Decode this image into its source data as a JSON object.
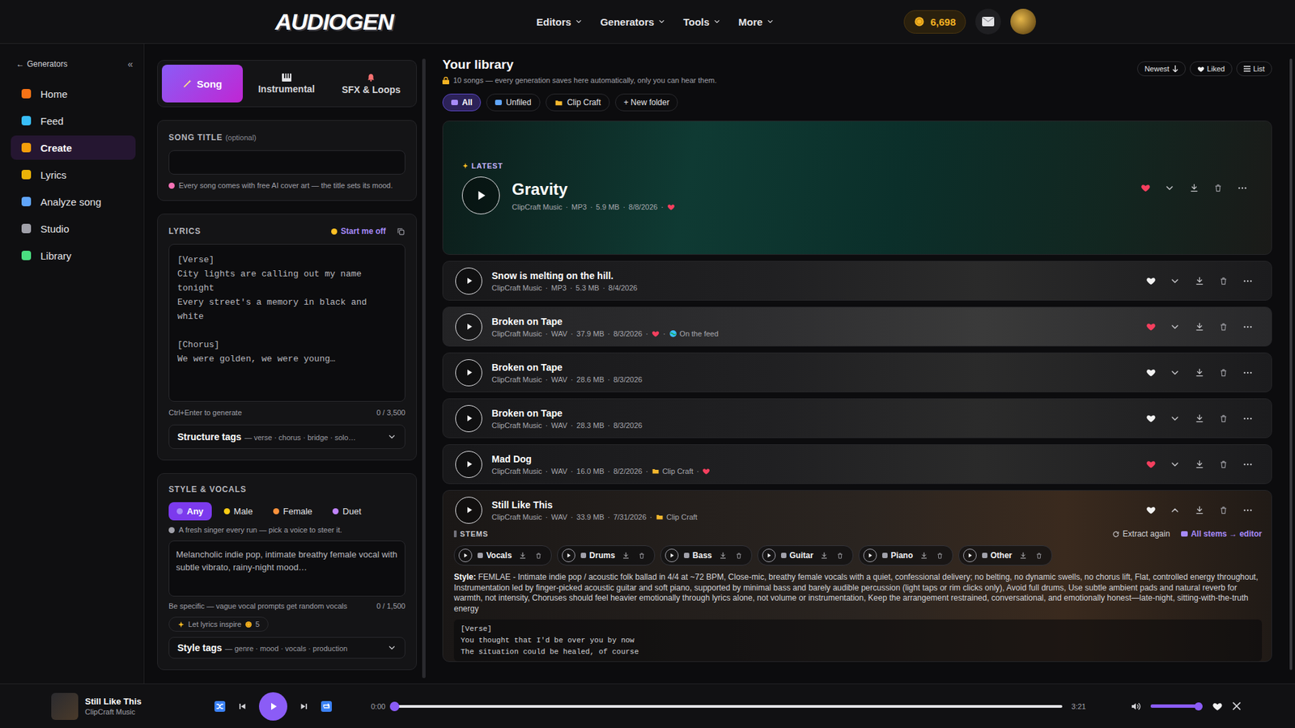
{
  "topbar": {
    "logo": "AUDIOGEN",
    "nav": [
      {
        "label": "Editors"
      },
      {
        "label": "Generators"
      },
      {
        "label": "Tools"
      },
      {
        "label": "More"
      }
    ],
    "credits": "6,698"
  },
  "sidebar": {
    "back": "←",
    "back_label": "Generators",
    "collapse": "«",
    "items": [
      {
        "label": "Home",
        "selected": false
      },
      {
        "label": "Feed",
        "selected": false
      },
      {
        "label": "Create",
        "selected": true
      },
      {
        "label": "Lyrics",
        "selected": false
      },
      {
        "label": "Analyze song",
        "selected": false
      },
      {
        "label": "Studio",
        "selected": false
      },
      {
        "label": "Library",
        "selected": false
      }
    ]
  },
  "create": {
    "tabs": [
      {
        "label": "Song",
        "selected": true
      },
      {
        "label": "Instrumental",
        "selected": false
      },
      {
        "label": "SFX & Loops",
        "selected": false
      }
    ],
    "title_field": {
      "label": "SONG TITLE",
      "optional": "(optional)",
      "value": "",
      "hint": "Every song comes with free AI cover art — the title sets its mood."
    },
    "lyrics": {
      "label": "LYRICS",
      "action": "Start me off",
      "placeholder": "[Verse]\nCity lights are calling out my name tonight\nEvery street's a memory in black and white\n\n[Chorus]\nWe were golden, we were young…",
      "shortcut": "Ctrl+Enter to generate",
      "count": "0 / 3,500",
      "structure_label": "Structure tags",
      "structure_hint": "— verse · chorus · bridge · solo…"
    },
    "style": {
      "label": "STYLE & VOCALS",
      "voices": [
        {
          "label": "Any",
          "selected": true
        },
        {
          "label": "Male",
          "selected": false
        },
        {
          "label": "Female",
          "selected": false
        },
        {
          "label": "Duet",
          "selected": false
        }
      ],
      "voice_hint": "A fresh singer every run — pick a voice to steer it.",
      "placeholder": "Melancholic indie pop, intimate breathy female vocal with subtle vibrato, rainy-night mood…",
      "hint": "Be specific — vague vocal prompts get random vocals",
      "count": "0 / 1,500",
      "inspire": "Let lyrics inspire",
      "inspire_cost": "5",
      "tags_label": "Style tags",
      "tags_hint": "— genre · mood · vocals · production"
    }
  },
  "library": {
    "title": "Your library",
    "subtitle": "10 songs — every generation saves here automatically, only you can hear them.",
    "sort": "Newest",
    "liked_filter": "Liked",
    "view": "List",
    "filters": [
      {
        "label": "All",
        "selected": true
      },
      {
        "label": "Unfiled",
        "selected": false
      },
      {
        "label": "Clip Craft",
        "selected": false
      }
    ],
    "new_folder": "+ New folder",
    "meta_separator": "·",
    "latest": {
      "tag": "LATEST",
      "title": "Gravity",
      "meta": [
        "ClipCraft Music",
        "MP3",
        "5.9 MB",
        "8/8/2026"
      ],
      "extras": [
        {
          "kind": "heart",
          "text": ""
        }
      ],
      "liked": true,
      "expanded": false,
      "highlighted": false
    },
    "rows": [
      {
        "title": "Snow is melting on the hill.",
        "meta": [
          "ClipCraft Music",
          "MP3",
          "5.3 MB",
          "8/4/2026"
        ],
        "extras": [],
        "liked": false,
        "expanded": false,
        "highlighted": false
      },
      {
        "title": "Broken on Tape",
        "meta": [
          "ClipCraft Music",
          "WAV",
          "37.9 MB",
          "8/3/2026"
        ],
        "extras": [
          {
            "kind": "heart",
            "text": ""
          },
          {
            "kind": "feed",
            "text": "On the feed"
          }
        ],
        "liked": true,
        "expanded": false,
        "highlighted": true
      },
      {
        "title": "Broken on Tape",
        "meta": [
          "ClipCraft Music",
          "WAV",
          "28.6 MB",
          "8/3/2026"
        ],
        "extras": [],
        "liked": false,
        "expanded": false,
        "highlighted": false
      },
      {
        "title": "Broken on Tape",
        "meta": [
          "ClipCraft Music",
          "WAV",
          "28.3 MB",
          "8/3/2026"
        ],
        "extras": [],
        "liked": false,
        "expanded": false,
        "highlighted": false
      },
      {
        "title": "Mad Dog",
        "meta": [
          "ClipCraft Music",
          "WAV",
          "16.0 MB",
          "8/2/2026"
        ],
        "extras": [
          {
            "kind": "folder",
            "text": "Clip Craft"
          },
          {
            "kind": "heart",
            "text": ""
          }
        ],
        "liked": true,
        "expanded": false,
        "highlighted": false
      },
      {
        "title": "Still Like This",
        "meta": [
          "ClipCraft Music",
          "WAV",
          "33.9 MB",
          "7/31/2026"
        ],
        "extras": [
          {
            "kind": "folder",
            "text": "Clip Craft"
          }
        ],
        "liked": false,
        "expanded": true,
        "highlighted": false
      }
    ],
    "detail": {
      "stems_label": "STEMS",
      "extract": "Extract again",
      "editor": "All stems → editor",
      "stems": [
        {
          "name": "Vocals"
        },
        {
          "name": "Drums"
        },
        {
          "name": "Bass"
        },
        {
          "name": "Guitar"
        },
        {
          "name": "Piano"
        },
        {
          "name": "Other"
        }
      ],
      "style_label": "Style:",
      "style_text": "FEMLAE - Intimate indie pop / acoustic folk ballad in 4/4 at ~72 BPM, Close-mic, breathy female vocals with a quiet, confessional delivery; no belting, no dynamic swells, no chorus lift, Flat, controlled energy throughout, Instrumentation led by finger-picked acoustic guitar and soft piano, supported by minimal bass and barely audible percussion (light taps or rim clicks only), Avoid full drums, Use subtle ambient pads and natural reverb for warmth, not intensity, Choruses should feel heavier emotionally through lyrics alone, not volume or instrumentation, Keep the arrangement restrained, conversational, and emotionally honest—late-night, sitting-with-the-truth energy",
      "lyrics": [
        "[Verse]",
        "You thought that I'd be over you by now",
        "The situation could be healed, of course"
      ]
    }
  },
  "player": {
    "title": "Still Like This",
    "artist": "ClipCraft Music",
    "elapsed": "0:00",
    "duration": "3:21",
    "progress": 0,
    "volume": 0.92
  }
}
